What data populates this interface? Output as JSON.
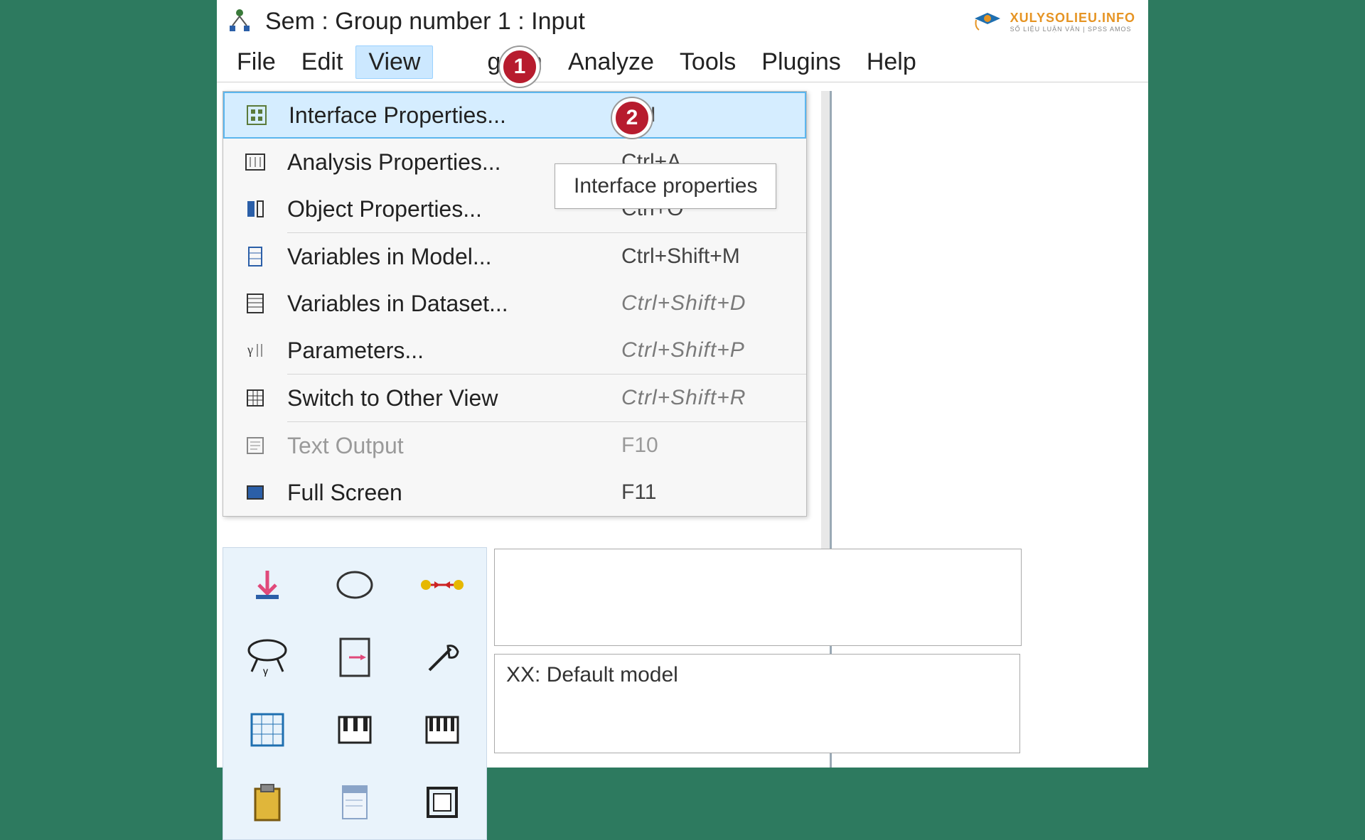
{
  "window": {
    "title": "Sem : Group number 1 : Input"
  },
  "watermark": {
    "line1": "XULYSOLIEU.INFO",
    "line2": "SỐ LIỆU LUẬN VĂN | SPSS AMOS"
  },
  "menubar": [
    {
      "label": "File"
    },
    {
      "label": "Edit"
    },
    {
      "label": "View",
      "selected": true
    },
    {
      "label": "gram"
    },
    {
      "label": "Analyze"
    },
    {
      "label": "Tools"
    },
    {
      "label": "Plugins"
    },
    {
      "label": "Help"
    }
  ],
  "badges": {
    "one": "1",
    "two": "2"
  },
  "dropdown": {
    "items": [
      {
        "label": "Interface Properties...",
        "shortcut": "trl+I",
        "highlight": true,
        "sep": false,
        "icon": "props-icon"
      },
      {
        "label": "Analysis Properties...",
        "shortcut": "Ctrl+A",
        "sep": false,
        "icon": "analysis-icon"
      },
      {
        "label": "Object Properties...",
        "shortcut": "Ctrl+O",
        "sep": true,
        "icon": "object-icon"
      },
      {
        "label": "Variables in Model...",
        "shortcut": "Ctrl+Shift+M",
        "sep": false,
        "icon": "vars-model-icon"
      },
      {
        "label": "Variables in Dataset...",
        "shortcut": "Ctrl+Shift+D",
        "sep": false,
        "icon": "vars-dataset-icon",
        "distorted": true
      },
      {
        "label": "Parameters...",
        "shortcut": "Ctrl+Shift+P",
        "sep": true,
        "icon": "parameters-icon",
        "distorted": true
      },
      {
        "label": "Switch to Other View",
        "shortcut": "Ctrl+Shift+R",
        "sep": true,
        "icon": "grid-icon",
        "distorted": true
      },
      {
        "label": "Text Output",
        "shortcut": "F10",
        "sep": false,
        "disabled": true,
        "icon": "text-output-icon"
      },
      {
        "label": "Full Screen",
        "shortcut": "F11",
        "sep": false,
        "icon": "full-screen-icon"
      }
    ]
  },
  "tooltip": "Interface properties",
  "status": {
    "model": "XX: Default model"
  },
  "toolbox_items": [
    "arrow-down-tool",
    "ellipse-tool",
    "dots-tool",
    "latent-tool",
    "page-tool",
    "wand-tool",
    "table-tool",
    "piano1-tool",
    "piano2-tool",
    "clipboard-tool",
    "doc-tool",
    "frame-tool"
  ]
}
